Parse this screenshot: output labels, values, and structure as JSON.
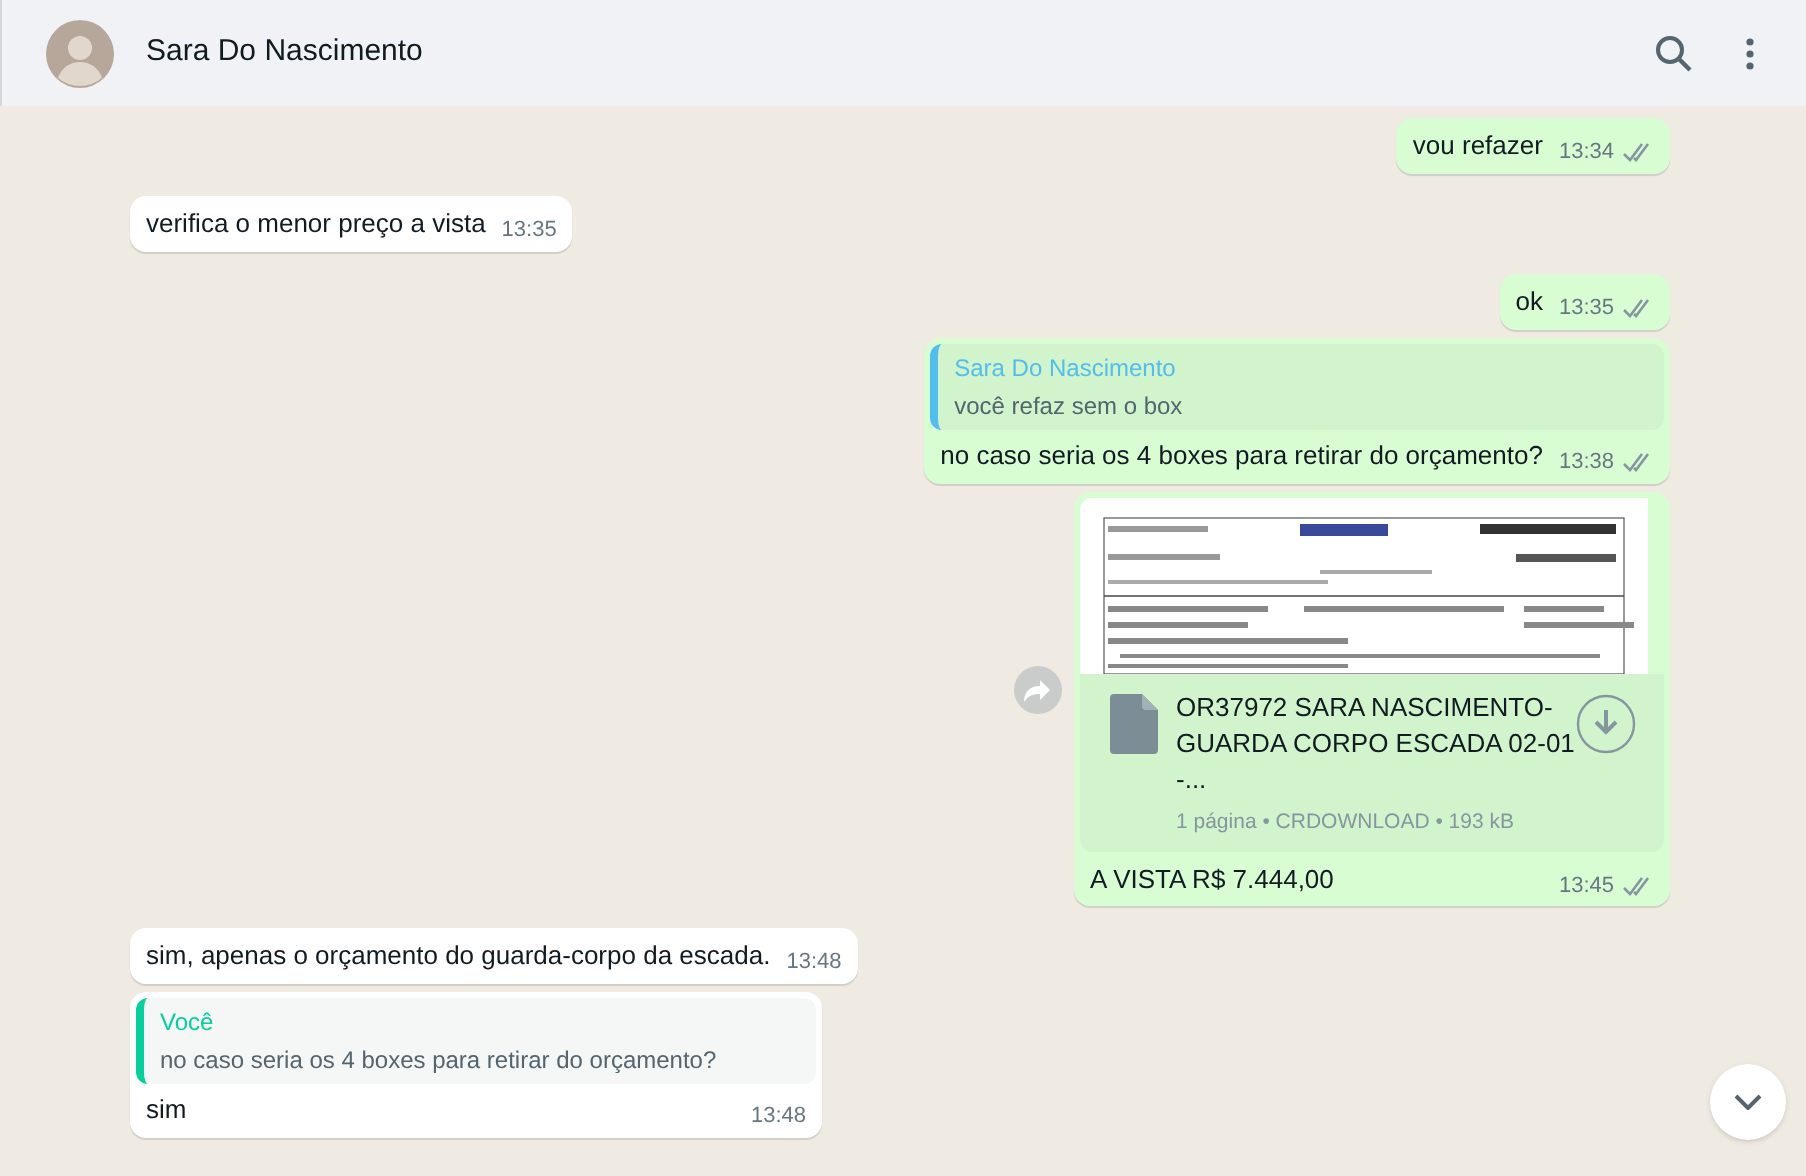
{
  "header": {
    "contact_name": "Sara Do Nascimento"
  },
  "messages": [
    {
      "kind": "text",
      "outgoing": true,
      "text": "vou refazer",
      "time": "13:34",
      "read": false
    },
    {
      "kind": "text",
      "outgoing": false,
      "text": "verifica o menor preço a vista",
      "time": "13:35"
    },
    {
      "kind": "text",
      "outgoing": true,
      "text": "ok",
      "time": "13:35",
      "read": false
    },
    {
      "kind": "quote",
      "outgoing": true,
      "quote_author": "Sara Do Nascimento",
      "quote_text": "você refaz sem o box",
      "text": "no caso seria os 4 boxes para retirar do orçamento?",
      "time": "13:38",
      "read": false
    },
    {
      "kind": "document",
      "outgoing": true,
      "file_name": "OR37972 SARA NASCIMENTO- GUARDA CORPO ESCADA 02-01-...",
      "file_meta": "1 página • CRDOWNLOAD • 193 kB",
      "text": "A VISTA R$ 7.444,00",
      "time": "13:45",
      "read": false
    },
    {
      "kind": "text",
      "outgoing": false,
      "text": "sim, apenas o orçamento do guarda-corpo da escada.",
      "time": "13:48"
    },
    {
      "kind": "quote",
      "outgoing": false,
      "quote_author": "Você",
      "quote_text": "no caso seria os 4 boxes para retirar do orçamento?",
      "text": "sim",
      "time": "13:48"
    }
  ]
}
